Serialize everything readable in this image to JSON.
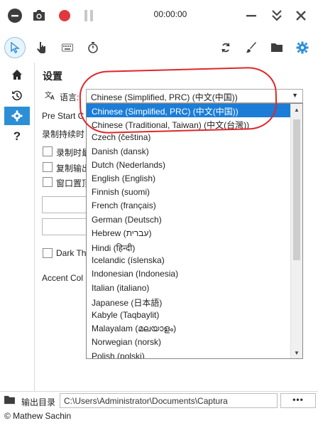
{
  "toolbar": {
    "timer": "00:00:00"
  },
  "nav": {
    "items": [
      "home-icon",
      "history-icon",
      "settings-icon",
      "help-icon"
    ],
    "selected": "settings-icon"
  },
  "settings": {
    "title": "设置",
    "language_label": "语言:",
    "language_selected": "Chinese (Simplified, PRC) (中文(中国))",
    "pre_start_label": "Pre Start C",
    "record_duration_label": "录制持续时",
    "checkbox_1": "录制时最",
    "checkbox_2": "复制输出",
    "checkbox_3": "窗口置顶",
    "dark_theme_label": "Dark Th",
    "accent_color_label": "Accent Col"
  },
  "dropdown": {
    "options": [
      "Chinese (Simplified, PRC) (中文(中国))",
      "Chinese (Traditional, Taiwan) (中文(台灣))",
      "Czech (čeština)",
      "Danish (dansk)",
      "Dutch (Nederlands)",
      "English (English)",
      "Finnish (suomi)",
      "French (français)",
      "German (Deutsch)",
      "Hebrew (עברית)",
      "Hindi (हिन्दी)",
      "Icelandic (íslenska)",
      "Indonesian (Indonesia)",
      "Italian (italiano)",
      "Japanese (日本語)",
      "Kabyle (Taqbaylit)",
      "Malayalam (മലയാളം)",
      "Norwegian (norsk)",
      "Polish (polski)"
    ],
    "selected_index": 0
  },
  "bottom": {
    "output_label": "输出目录",
    "output_path": "C:\\Users\\Administrator\\Documents\\Captura",
    "browse_label": "•••"
  },
  "footer": "© Mathew Sachin",
  "colors": {
    "accent": "#2c8fd6",
    "record": "#e0383e",
    "annotation": "#e0262a",
    "selection": "#1b7dd7"
  }
}
